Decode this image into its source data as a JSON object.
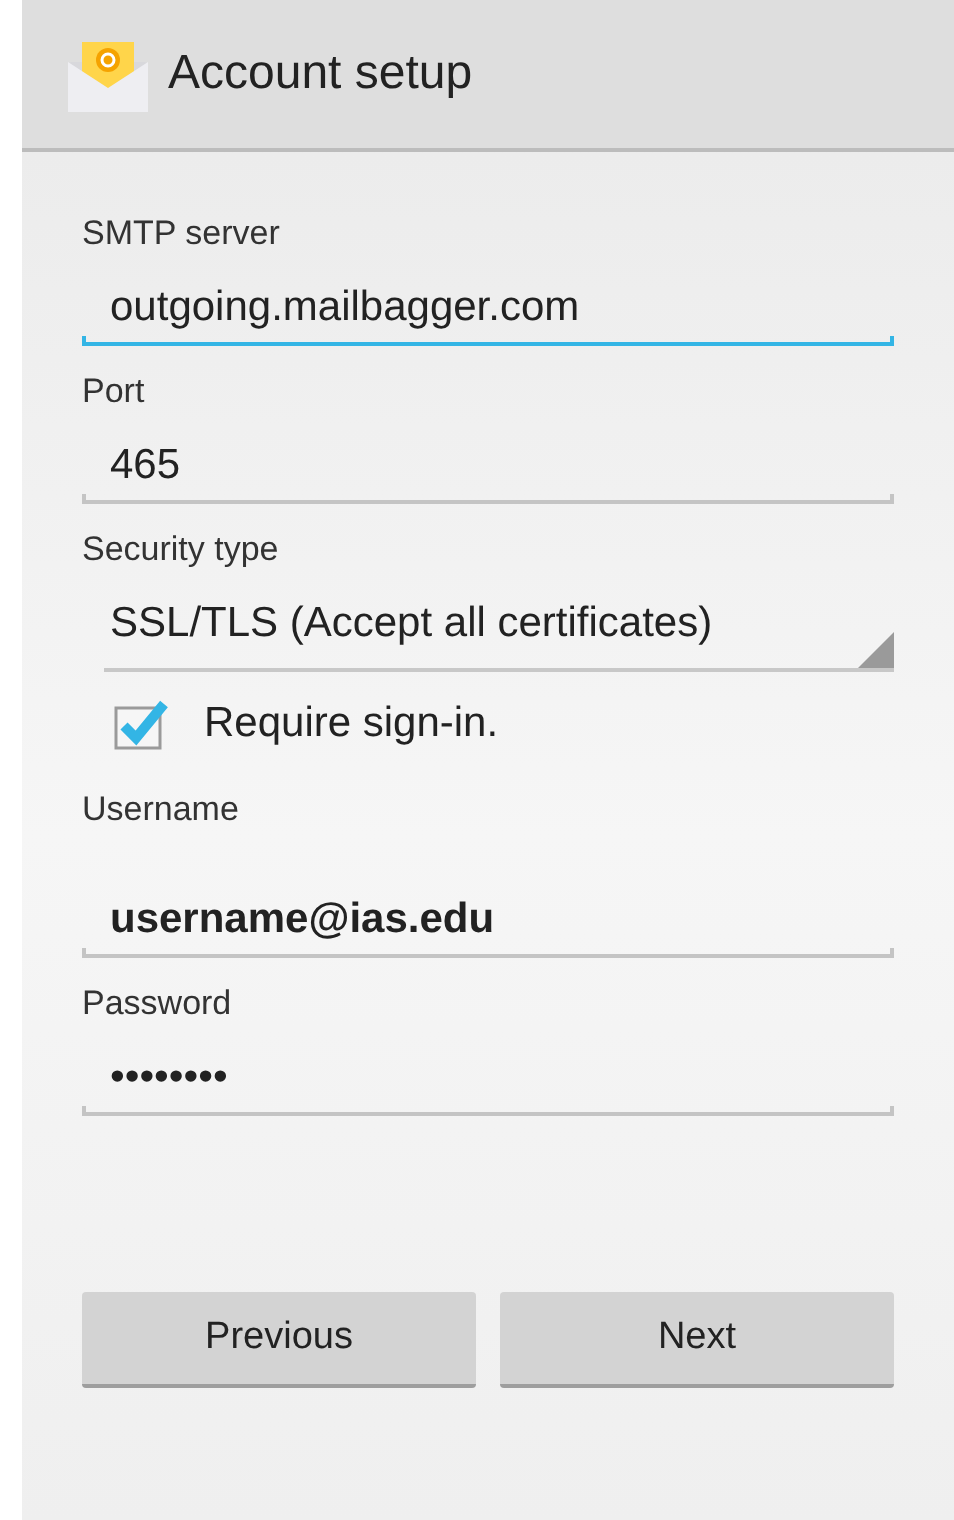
{
  "action_bar": {
    "title": "Account setup"
  },
  "fields": [
    {
      "kind": "text",
      "label": "SMTP server",
      "value": "outgoing.mailbagger.com",
      "focused": true,
      "bold": false
    },
    {
      "kind": "text",
      "label": "Port",
      "value": "465",
      "focused": false,
      "bold": false
    },
    {
      "kind": "spinner",
      "label": "Security type",
      "value": "SSL/TLS (Accept all certificates)"
    },
    {
      "kind": "checkbox",
      "label": "Require sign-in.",
      "checked": true
    },
    {
      "kind": "text",
      "label": "Username",
      "value": "username@ias.edu",
      "focused": false,
      "bold": true
    },
    {
      "kind": "text",
      "label": "Password",
      "value": "••••••••",
      "focused": false,
      "bold": false
    }
  ],
  "buttons": [
    "Previous",
    "Next"
  ]
}
